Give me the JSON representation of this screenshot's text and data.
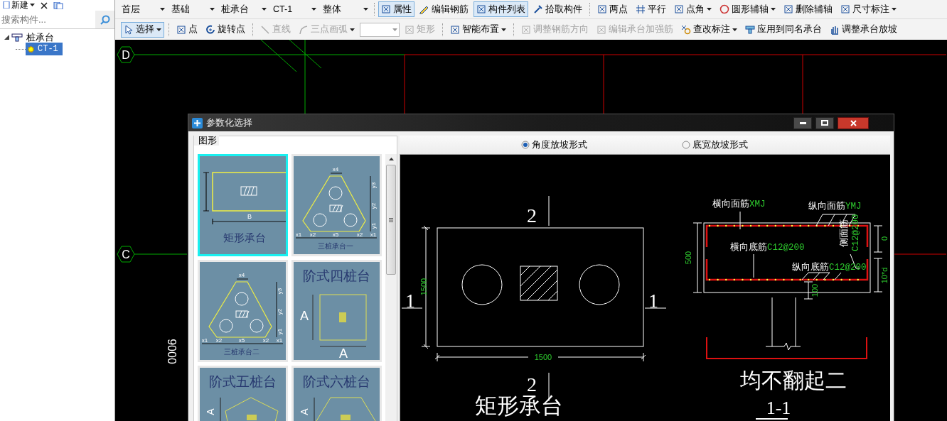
{
  "left_panel": {
    "new_button": {
      "label": "新建"
    },
    "search": {
      "placeholder": "搜索构件..."
    },
    "tree": [
      {
        "label": "桩承台",
        "expanded": true,
        "selected": false,
        "children": [
          {
            "label": "CT-1",
            "selected": true
          }
        ]
      }
    ]
  },
  "toolbar_1": {
    "selectors": [
      "首层",
      "基础",
      "桩承台",
      "CT-1",
      "整体"
    ],
    "buttons": [
      {
        "kind": "button",
        "label": "属性",
        "pressed": true,
        "disabled": false,
        "menu": false
      },
      {
        "kind": "button",
        "label": "编辑钢筋",
        "pressed": false,
        "disabled": false,
        "menu": false
      },
      {
        "kind": "button",
        "label": "构件列表",
        "pressed": true,
        "disabled": false,
        "menu": false
      },
      {
        "kind": "button",
        "label": "拾取构件",
        "pressed": false,
        "disabled": false,
        "menu": false
      },
      {
        "kind": "separator"
      },
      {
        "kind": "button",
        "label": "两点",
        "pressed": false,
        "disabled": false,
        "menu": false
      },
      {
        "kind": "button",
        "label": "平行",
        "pressed": false,
        "disabled": false,
        "menu": false
      },
      {
        "kind": "button",
        "label": "点角",
        "pressed": false,
        "disabled": false,
        "menu": true
      },
      {
        "kind": "button",
        "label": "圆形辅轴",
        "pressed": false,
        "disabled": false,
        "menu": true
      },
      {
        "kind": "button",
        "label": "删除辅轴",
        "pressed": false,
        "disabled": false,
        "menu": false
      },
      {
        "kind": "button",
        "label": "尺寸标注",
        "pressed": false,
        "disabled": false,
        "menu": true
      }
    ]
  },
  "toolbar_2": {
    "buttons": [
      {
        "kind": "button",
        "label": "选择",
        "pressed": true,
        "disabled": false,
        "menu": true
      },
      {
        "kind": "separator"
      },
      {
        "kind": "button",
        "label": "点",
        "pressed": false,
        "disabled": false,
        "menu": false
      },
      {
        "kind": "button",
        "label": "旋转点",
        "pressed": false,
        "disabled": false,
        "menu": false
      },
      {
        "kind": "separator"
      },
      {
        "kind": "button",
        "label": "直线",
        "pressed": false,
        "disabled": true,
        "menu": false
      },
      {
        "kind": "button",
        "label": "三点画弧",
        "pressed": false,
        "disabled": true,
        "menu": true
      },
      {
        "kind": "combo"
      },
      {
        "kind": "button",
        "label": "矩形",
        "pressed": false,
        "disabled": true,
        "menu": false
      },
      {
        "kind": "separator"
      },
      {
        "kind": "button",
        "label": "智能布置",
        "pressed": false,
        "disabled": false,
        "menu": true
      },
      {
        "kind": "separator"
      },
      {
        "kind": "button",
        "label": "调整钢筋方向",
        "pressed": false,
        "disabled": true,
        "menu": false
      },
      {
        "kind": "button",
        "label": "编辑承台加强筋",
        "pressed": false,
        "disabled": true,
        "menu": false
      },
      {
        "kind": "button",
        "label": "查改标注",
        "pressed": false,
        "disabled": false,
        "menu": true
      },
      {
        "kind": "button",
        "label": "应用到同名承台",
        "pressed": false,
        "disabled": false,
        "menu": false
      },
      {
        "kind": "button",
        "label": "调整承台放坡",
        "pressed": false,
        "disabled": false,
        "menu": false
      }
    ]
  },
  "canvas": {
    "axis_labels": [
      "D",
      "C"
    ],
    "dimension": "9000"
  },
  "dialog": {
    "title": "参数化选择",
    "group_label": "图形",
    "thumbnails": [
      {
        "kind": "rect",
        "label": "矩形承台",
        "selected": true,
        "dims": [
          "B"
        ]
      },
      {
        "kind": "three_pile",
        "label": "三桩承台一",
        "selected": false,
        "dims": [
          "x4",
          "y3",
          "y2",
          "y1",
          "x1",
          "x2",
          "x5",
          "x2",
          "x1"
        ]
      },
      {
        "kind": "three_pile",
        "label": "三桩承台二",
        "selected": false,
        "dims": [
          "x4",
          "y3",
          "y2",
          "y1",
          "x1",
          "x2",
          "x5",
          "x2",
          "x1"
        ]
      },
      {
        "kind": "step_square",
        "label": "阶式四桩台",
        "selected": false,
        "dims": [
          "A",
          "A"
        ]
      },
      {
        "kind": "step_pentagon",
        "label": "阶式五桩台",
        "selected": false,
        "dims": [
          "A"
        ]
      },
      {
        "kind": "step_hexagon",
        "label": "阶式六桩台",
        "selected": false,
        "dims": [
          "A"
        ]
      }
    ],
    "radios": [
      {
        "label": "角度放坡形式",
        "selected": true
      },
      {
        "label": "底宽放坡形式",
        "selected": false
      }
    ],
    "plan": {
      "title": "矩形承台",
      "section_marks": [
        "2",
        "2",
        "1",
        "1"
      ],
      "dims": [
        "1500",
        "1500"
      ]
    },
    "section": {
      "title": "均不翻起二",
      "label": "1-1",
      "callouts": [
        {
          "name": "横向面筋",
          "spec": "XMJ"
        },
        {
          "name": "纵向面筋",
          "spec": "YMJ"
        },
        {
          "name": "横向底筋",
          "spec": "C12@200"
        },
        {
          "name": "纵向底筋",
          "spec": "C12@200"
        },
        {
          "name": "侧面筋",
          "spec": "C12@200"
        }
      ],
      "dims": [
        "500",
        "0",
        "10*d",
        "100"
      ]
    }
  }
}
